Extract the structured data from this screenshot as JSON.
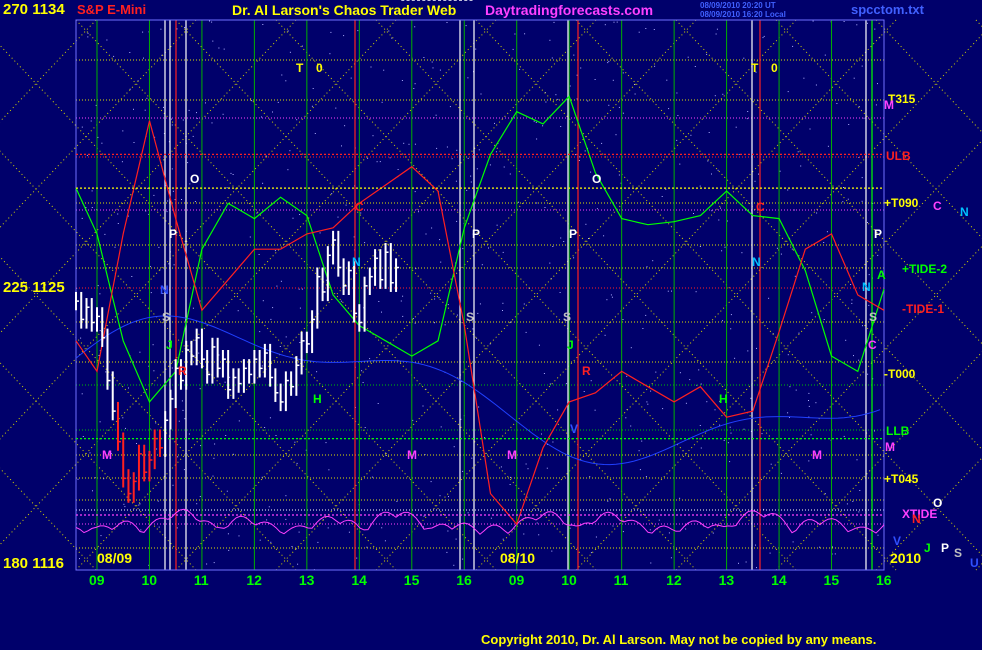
{
  "header": {
    "left_price": "270 1134",
    "instrument": "S&P E-Mini",
    "title": "Dr. Al Larson's Chaos Trader Web",
    "website": "Daytradingforecasts.com",
    "stamp_line1": "08/09/2010 20:20 UT",
    "stamp_line2": "08/09/2010 16:20 Local",
    "file_name": "spcctom.txt"
  },
  "left_axis": {
    "mid_label": "225 1125",
    "bottom_label": "180 1116"
  },
  "footer": {
    "date_left": "08/09",
    "date_mid": "08/10",
    "year": "2010",
    "copyright": "Copyright 2010, Dr. Al Larson. May not be copied by any means."
  },
  "hour_ticks": [
    "09",
    "10",
    "11",
    "12",
    "13",
    "14",
    "15",
    "16",
    "09",
    "10",
    "11",
    "12",
    "13",
    "14",
    "15",
    "16"
  ],
  "right_labels": [
    {
      "text": "T315",
      "color": "#ffff00"
    },
    {
      "text": "ULB",
      "color": "#ff2020"
    },
    {
      "text": "+T090",
      "color": "#ffff00"
    },
    {
      "text": "+TIDE-2",
      "color": "#00ff00"
    },
    {
      "text": "-TIDE-1",
      "color": "#ff2020"
    },
    {
      "text": "-T000",
      "color": "#ffff00"
    },
    {
      "text": "LLB",
      "color": "#00ff00"
    },
    {
      "text": "+T045",
      "color": "#ffff00"
    },
    {
      "text": "XTIDE",
      "color": "#ff40ff"
    }
  ],
  "legend_letters": [
    {
      "text": "M",
      "color": "#ff40ff"
    },
    {
      "text": "C",
      "color": "#ff40ff"
    },
    {
      "text": "N",
      "color": "#00c0ff"
    },
    {
      "text": "O",
      "color": "#ffffff"
    },
    {
      "text": "N",
      "color": "#ff2020"
    },
    {
      "text": "V",
      "color": "#3050ff"
    },
    {
      "text": "J",
      "color": "#00ff00"
    },
    {
      "text": "P",
      "color": "#ffffff"
    },
    {
      "text": "S",
      "color": "#c0c0c0"
    },
    {
      "text": "U",
      "color": "#3050ff"
    }
  ],
  "cycle_markers": [
    {
      "text": "T",
      "color": "#ffff00"
    },
    {
      "text": "0",
      "color": "#ffff00"
    },
    {
      "text": "T",
      "color": "#ffff00"
    },
    {
      "text": "0",
      "color": "#ffff00"
    },
    {
      "text": "O",
      "color": "#ffffff"
    },
    {
      "text": "O",
      "color": "#ffffff"
    },
    {
      "text": "P",
      "color": "#ffffff"
    },
    {
      "text": "P",
      "color": "#ffffff"
    },
    {
      "text": "P",
      "color": "#ffffff"
    },
    {
      "text": "P",
      "color": "#ffffff"
    },
    {
      "text": "C",
      "color": "#ff2020"
    },
    {
      "text": "C",
      "color": "#ff2020"
    },
    {
      "text": "N",
      "color": "#00c0ff"
    },
    {
      "text": "N",
      "color": "#00c0ff"
    },
    {
      "text": "N",
      "color": "#00c0ff"
    },
    {
      "text": "S",
      "color": "#c0c0c0"
    },
    {
      "text": "S",
      "color": "#c0c0c0"
    },
    {
      "text": "S",
      "color": "#c0c0c0"
    },
    {
      "text": "S",
      "color": "#c0c0c0"
    },
    {
      "text": "J",
      "color": "#00ff00"
    },
    {
      "text": "J",
      "color": "#00ff00"
    },
    {
      "text": "R",
      "color": "#ff2020"
    },
    {
      "text": "R",
      "color": "#ff2020"
    },
    {
      "text": "H",
      "color": "#00ff00"
    },
    {
      "text": "H",
      "color": "#00ff00"
    },
    {
      "text": "M",
      "color": "#ff40ff"
    },
    {
      "text": "M",
      "color": "#ff40ff"
    },
    {
      "text": "M",
      "color": "#ff40ff"
    },
    {
      "text": "M",
      "color": "#ff40ff"
    },
    {
      "text": "M",
      "color": "#ff40ff"
    },
    {
      "text": "V",
      "color": "#3050ff"
    },
    {
      "text": "N",
      "color": "#3050ff"
    },
    {
      "text": "A",
      "color": "#00ff00"
    },
    {
      "text": "C",
      "color": "#ff40ff"
    }
  ],
  "chart_data": {
    "type": "line",
    "title": "Dr. Al Larson's Chaos Trader Web",
    "subtitle": "S&P E-Mini",
    "sessions": [
      "08/09",
      "08/10"
    ],
    "x_ticks": [
      "09",
      "10",
      "11",
      "12",
      "13",
      "14",
      "15",
      "16",
      "09",
      "10",
      "11",
      "12",
      "13",
      "14",
      "15",
      "16"
    ],
    "ylim": [
      1116,
      1134
    ],
    "y_ticks_price": [
      1116,
      1125,
      1134
    ],
    "y_ticks_angle": [
      180,
      225,
      270
    ],
    "grid": true,
    "price_bars": {
      "x_hours": [
        8.6,
        8.7,
        8.8,
        8.9,
        9.0,
        9.1,
        9.2,
        9.3,
        9.4,
        9.5,
        9.6,
        9.7,
        9.8,
        9.9,
        10.0,
        10.1,
        10.2,
        10.3,
        10.4,
        10.5,
        10.6,
        10.7,
        10.8,
        10.9,
        11.0,
        11.1,
        11.2,
        11.3,
        11.4,
        11.5,
        11.6,
        11.7,
        11.8,
        11.9,
        12.0,
        12.1,
        12.2,
        12.3,
        12.4,
        12.5,
        12.6,
        12.7,
        12.8,
        12.9,
        13.0,
        13.1,
        13.2,
        13.3,
        13.4,
        13.5,
        13.6,
        13.7,
        13.8,
        13.9,
        14.0,
        14.1,
        14.2,
        14.3,
        14.4,
        14.5,
        14.6,
        14.7,
        14.8,
        14.9,
        15.0,
        15.1,
        15.2,
        15.3,
        15.4,
        15.5,
        15.6,
        15.7,
        15.8,
        15.9,
        16.0,
        16.1
      ],
      "close": [
        1124.8,
        1124.2,
        1124.6,
        1124.1,
        1124.3,
        1123.6,
        1122.2,
        1121.2,
        1120.2,
        1119.0,
        1118.5,
        1118.9,
        1119.8,
        1119.2,
        1119.6,
        1120.3,
        1120.0,
        1120.9,
        1121.6,
        1122.6,
        1122.2,
        1123.2,
        1123.0,
        1123.6,
        1122.9,
        1122.4,
        1123.3,
        1122.6,
        1122.9,
        1121.9,
        1122.3,
        1122.1,
        1122.6,
        1122.4,
        1122.9,
        1122.6,
        1123.1,
        1122.3,
        1121.8,
        1121.5,
        1122.2,
        1122.0,
        1122.7,
        1123.5,
        1123.4,
        1124.2,
        1125.6,
        1125.1,
        1126.3,
        1126.8,
        1125.9,
        1125.3,
        1125.8,
        1124.4,
        1124.1,
        1125.3,
        1125.6,
        1126.2,
        1125.5,
        1126.4,
        1125.4,
        1125.9
      ]
    },
    "series": [
      {
        "name": "TIDE-2",
        "color": "#00ff00",
        "x_hours": [
          8.6,
          9.0,
          9.5,
          10.0,
          10.5,
          11.0,
          11.5,
          12.0,
          12.5,
          13.0,
          13.5,
          14.0,
          14.5,
          15.0,
          15.5,
          16.0,
          16.5,
          17.0,
          17.5,
          18.0,
          18.5,
          19.0,
          19.5,
          20.0,
          20.5,
          21.0,
          21.5,
          22.0,
          22.5,
          23.0,
          23.5,
          24.0
        ],
        "y": [
          1128.5,
          1127.0,
          1123.5,
          1121.5,
          1122.5,
          1126.5,
          1128.0,
          1127.5,
          1128.2,
          1127.6,
          1125.0,
          1124.0,
          1123.5,
          1123.0,
          1123.5,
          1127.2,
          1129.6,
          1131.0,
          1130.6,
          1131.5,
          1129.0,
          1127.5,
          1127.3,
          1127.4,
          1127.6,
          1128.4,
          1127.6,
          1127.5,
          1125.8,
          1123.0,
          1122.5,
          1125.2
        ]
      },
      {
        "name": "TIDE-1",
        "color": "#ff2020",
        "x_hours": [
          8.6,
          9.0,
          9.5,
          10.0,
          10.5,
          11.0,
          11.5,
          12.0,
          12.5,
          13.0,
          13.5,
          14.0,
          14.5,
          15.0,
          15.5,
          16.0,
          16.5,
          17.0,
          17.5,
          18.0,
          18.5,
          19.0,
          19.5,
          20.0,
          20.5,
          21.0,
          21.5,
          22.0,
          22.5,
          23.0,
          23.5,
          24.0
        ],
        "y": [
          1123.5,
          1122.5,
          1127.0,
          1130.7,
          1127.5,
          1124.5,
          1125.5,
          1126.5,
          1126.5,
          1127.0,
          1127.2,
          1128.0,
          1128.6,
          1129.2,
          1128.4,
          1124.0,
          1118.5,
          1117.5,
          1120.0,
          1121.5,
          1121.8,
          1122.5,
          1122.0,
          1121.5,
          1122.0,
          1121.0,
          1121.2,
          1123.8,
          1126.5,
          1127.0,
          1125.0,
          1124.5
        ]
      },
      {
        "name": "ULB",
        "color": "#ff2020",
        "x_hours": [
          8.6,
          24.0
        ],
        "y": [
          1129.6,
          1129.6
        ]
      },
      {
        "name": "T090",
        "color": "#ffff00",
        "x_hours": [
          8.6,
          24.0
        ],
        "y": [
          1128.5,
          1128.5
        ]
      },
      {
        "name": "LLB",
        "color": "#00ff00",
        "x_hours": [
          8.6,
          24.0
        ],
        "y": [
          1120.3,
          1120.3
        ]
      },
      {
        "name": "XTIDE",
        "color": "#ff40ff",
        "x_hours": [
          8.6,
          24.0
        ],
        "y": [
          1117.8,
          1117.8
        ]
      }
    ],
    "annotations": [
      "T315",
      "ULB",
      "+T090",
      "+TIDE-2",
      "-TIDE-1",
      "-T000",
      "LLB",
      "+T045",
      "XTIDE"
    ]
  }
}
